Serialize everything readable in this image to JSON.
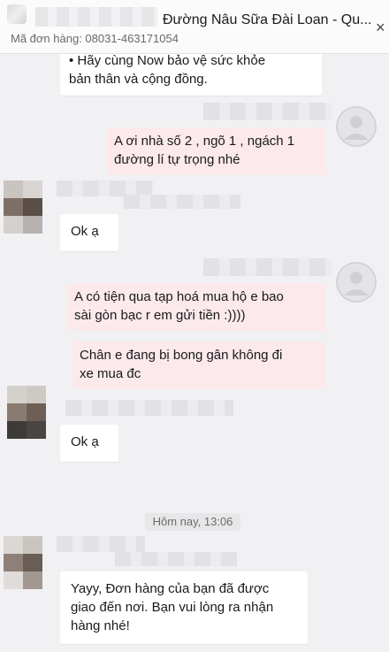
{
  "header": {
    "title": "Đường Nâu Sữa Đài Loan - Qu...",
    "order_label": "Mã đơn hàng: 08031-463171054",
    "close_glyph": "×"
  },
  "messages": {
    "m1": {
      "line1": "• Hãy cùng Now bảo vệ sức khỏe",
      "line2": "bản thân và cộng đồng."
    },
    "m2": {
      "line1": "A ơi nhà số 2 , ngõ 1 , ngách 1",
      "line2": "đường lí tự trọng nhé"
    },
    "m3": {
      "text": "Ok ạ"
    },
    "m4": {
      "line1": "A có tiện qua tạp hoá mua hộ e bao",
      "line2": "sài gòn bạc r em gửi tiền :))))"
    },
    "m5": {
      "line1": "Chân e đang bị bong gân không đi",
      "line2": "xe mua đc"
    },
    "m6": {
      "text": "Ok ạ"
    },
    "m7": {
      "line1": "Yayy, Đơn hàng của bạn đã được",
      "line2": "giao đến nơi. Bạn vui lòng ra nhận",
      "line3": "hàng nhé!"
    }
  },
  "timestamp": "Hôm nay, 13:06",
  "colors": {
    "outgoing_bubble": "#fbe9ec",
    "incoming_bubble": "#ffffff",
    "background": "#f1f1f3"
  }
}
